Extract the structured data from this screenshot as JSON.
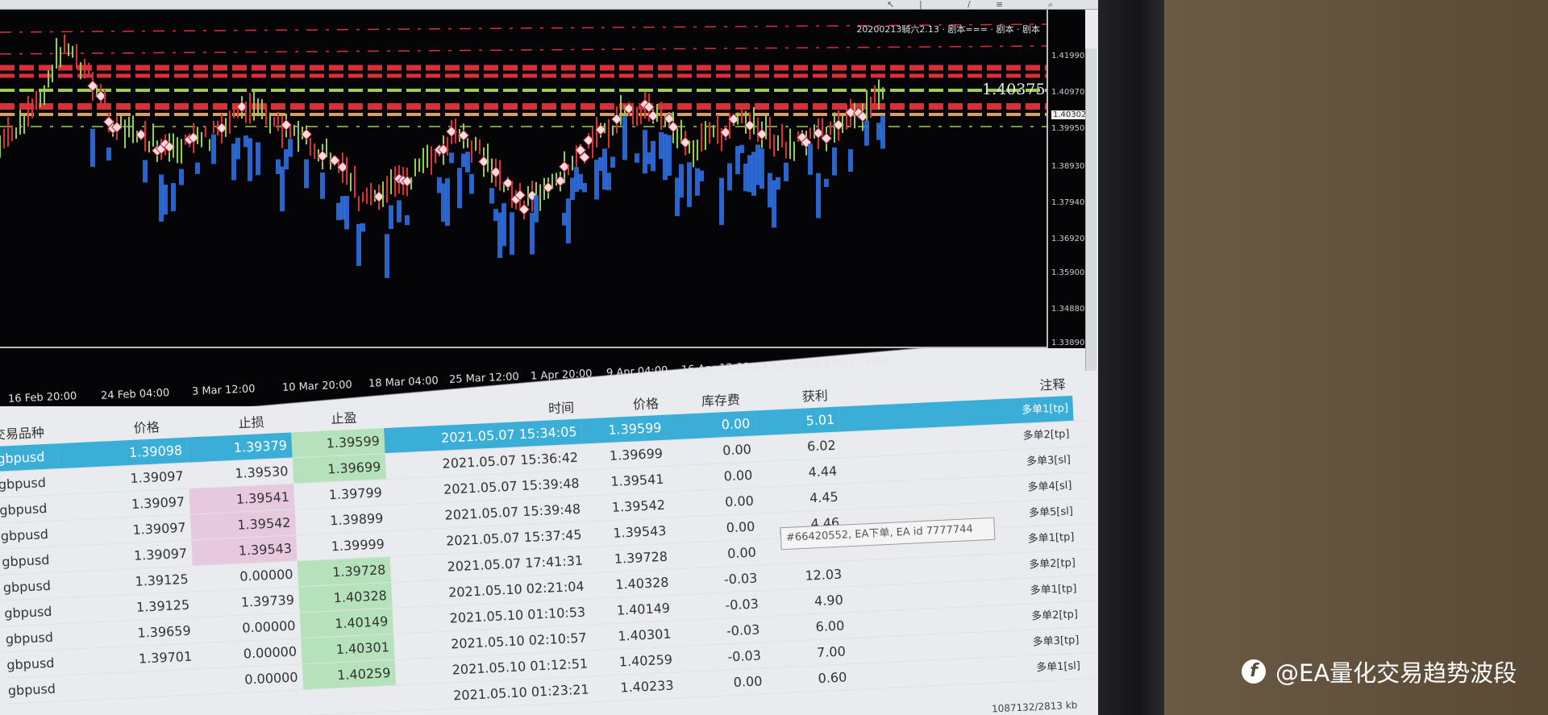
{
  "chart": {
    "title": "20200213騎六2.13 · 剧本=== · 剧本 · 剧本",
    "price_label": "1.40375",
    "current_price": "1.40302",
    "price_axis": [
      "1.41990",
      "1.40970",
      "1.39950",
      "1.38930",
      "1.37940",
      "1.36920",
      "1.35900",
      "1.34880",
      "1.33890"
    ],
    "time_axis": [
      "16 Feb 20:00",
      "24 Feb 04:00",
      "3 Mar 12:00",
      "10 Mar 20:00",
      "18 Mar 04:00",
      "25 Mar 12:00",
      "1 Apr 20:00",
      "9 Apr 04:00",
      "16 Apr 12:00",
      "23 Apr 20:00",
      "3 May 04:00"
    ],
    "colors": {
      "bull": "#e03030",
      "bear": "#8fd14f",
      "order": "#2f6fe0",
      "level": "#d8303a",
      "level_green": "#9ccc50"
    }
  },
  "table": {
    "headers": {
      "symbol": "交易品种",
      "price": "价格",
      "sl": "止损",
      "tp": "止盈",
      "time": "时间",
      "close_price": "价格",
      "swap": "库存费",
      "profit": "获利",
      "comment": "注释"
    },
    "rows": [
      {
        "symbol": "gbpusd",
        "price": "1.39098",
        "sl": "1.39379",
        "tp": "1.39599",
        "time": "2021.05.07 15:34:05",
        "close_price": "1.39599",
        "swap": "0.00",
        "profit": "5.01",
        "comment": "多单1[tp]"
      },
      {
        "symbol": "gbpusd",
        "price": "1.39097",
        "sl": "1.39530",
        "tp": "1.39699",
        "time": "2021.05.07 15:36:42",
        "close_price": "1.39699",
        "swap": "0.00",
        "profit": "6.02",
        "comment": "多单2[tp]"
      },
      {
        "symbol": "gbpusd",
        "price": "1.39097",
        "sl": "1.39541",
        "tp": "1.39799",
        "time": "2021.05.07 15:39:48",
        "close_price": "1.39541",
        "swap": "0.00",
        "profit": "4.44",
        "comment": "多单3[sl]"
      },
      {
        "symbol": "gbpusd",
        "price": "1.39097",
        "sl": "1.39542",
        "tp": "1.39899",
        "time": "2021.05.07 15:39:48",
        "close_price": "1.39542",
        "swap": "0.00",
        "profit": "4.45",
        "comment": "多单4[sl]"
      },
      {
        "symbol": "gbpusd",
        "price": "1.39097",
        "sl": "1.39543",
        "tp": "1.39999",
        "time": "2021.05.07 15:37:45",
        "close_price": "1.39543",
        "swap": "0.00",
        "profit": "4.46",
        "comment": "多单5[sl]"
      },
      {
        "symbol": "gbpusd",
        "price": "1.39125",
        "sl": "0.00000",
        "tp": "1.39728",
        "time": "2021.05.07 17:41:31",
        "close_price": "1.39728",
        "swap": "0.00",
        "comment": "多单1[tp]"
      },
      {
        "symbol": "gbpusd",
        "price": "1.39125",
        "sl": "1.39739",
        "tp": "1.40328",
        "time": "2021.05.10 02:21:04",
        "close_price": "1.40328",
        "swap": "-0.03",
        "profit": "12.03",
        "comment": "多单2[tp]"
      },
      {
        "symbol": "gbpusd",
        "price": "1.39659",
        "sl": "0.00000",
        "tp": "1.40149",
        "time": "2021.05.10 01:10:53",
        "close_price": "1.40149",
        "swap": "-0.03",
        "profit": "4.90",
        "comment": "多单1[tp]"
      },
      {
        "symbol": "gbpusd",
        "price": "1.39701",
        "sl": "0.00000",
        "tp": "1.40301",
        "time": "2021.05.10 02:10:57",
        "close_price": "1.40301",
        "swap": "-0.03",
        "profit": "6.00",
        "comment": "多单2[tp]"
      },
      {
        "symbol": "gbpusd",
        "sl": "0.00000",
        "tp": "1.40259",
        "time": "2021.05.10 01:12:51",
        "close_price": "1.40259",
        "swap": "-0.03",
        "profit": "7.00",
        "comment": "多单3[tp]"
      },
      {
        "time": "2021.05.10 01:23:21",
        "close_price": "1.40233",
        "swap": "0.00",
        "profit": "0.60",
        "comment": "多单1[sl]"
      }
    ]
  },
  "tooltip": "#66420552, EA下单, EA id 7777744",
  "status": "1087132/2813 kb",
  "watermark": "@EA量化交易趋势波段"
}
